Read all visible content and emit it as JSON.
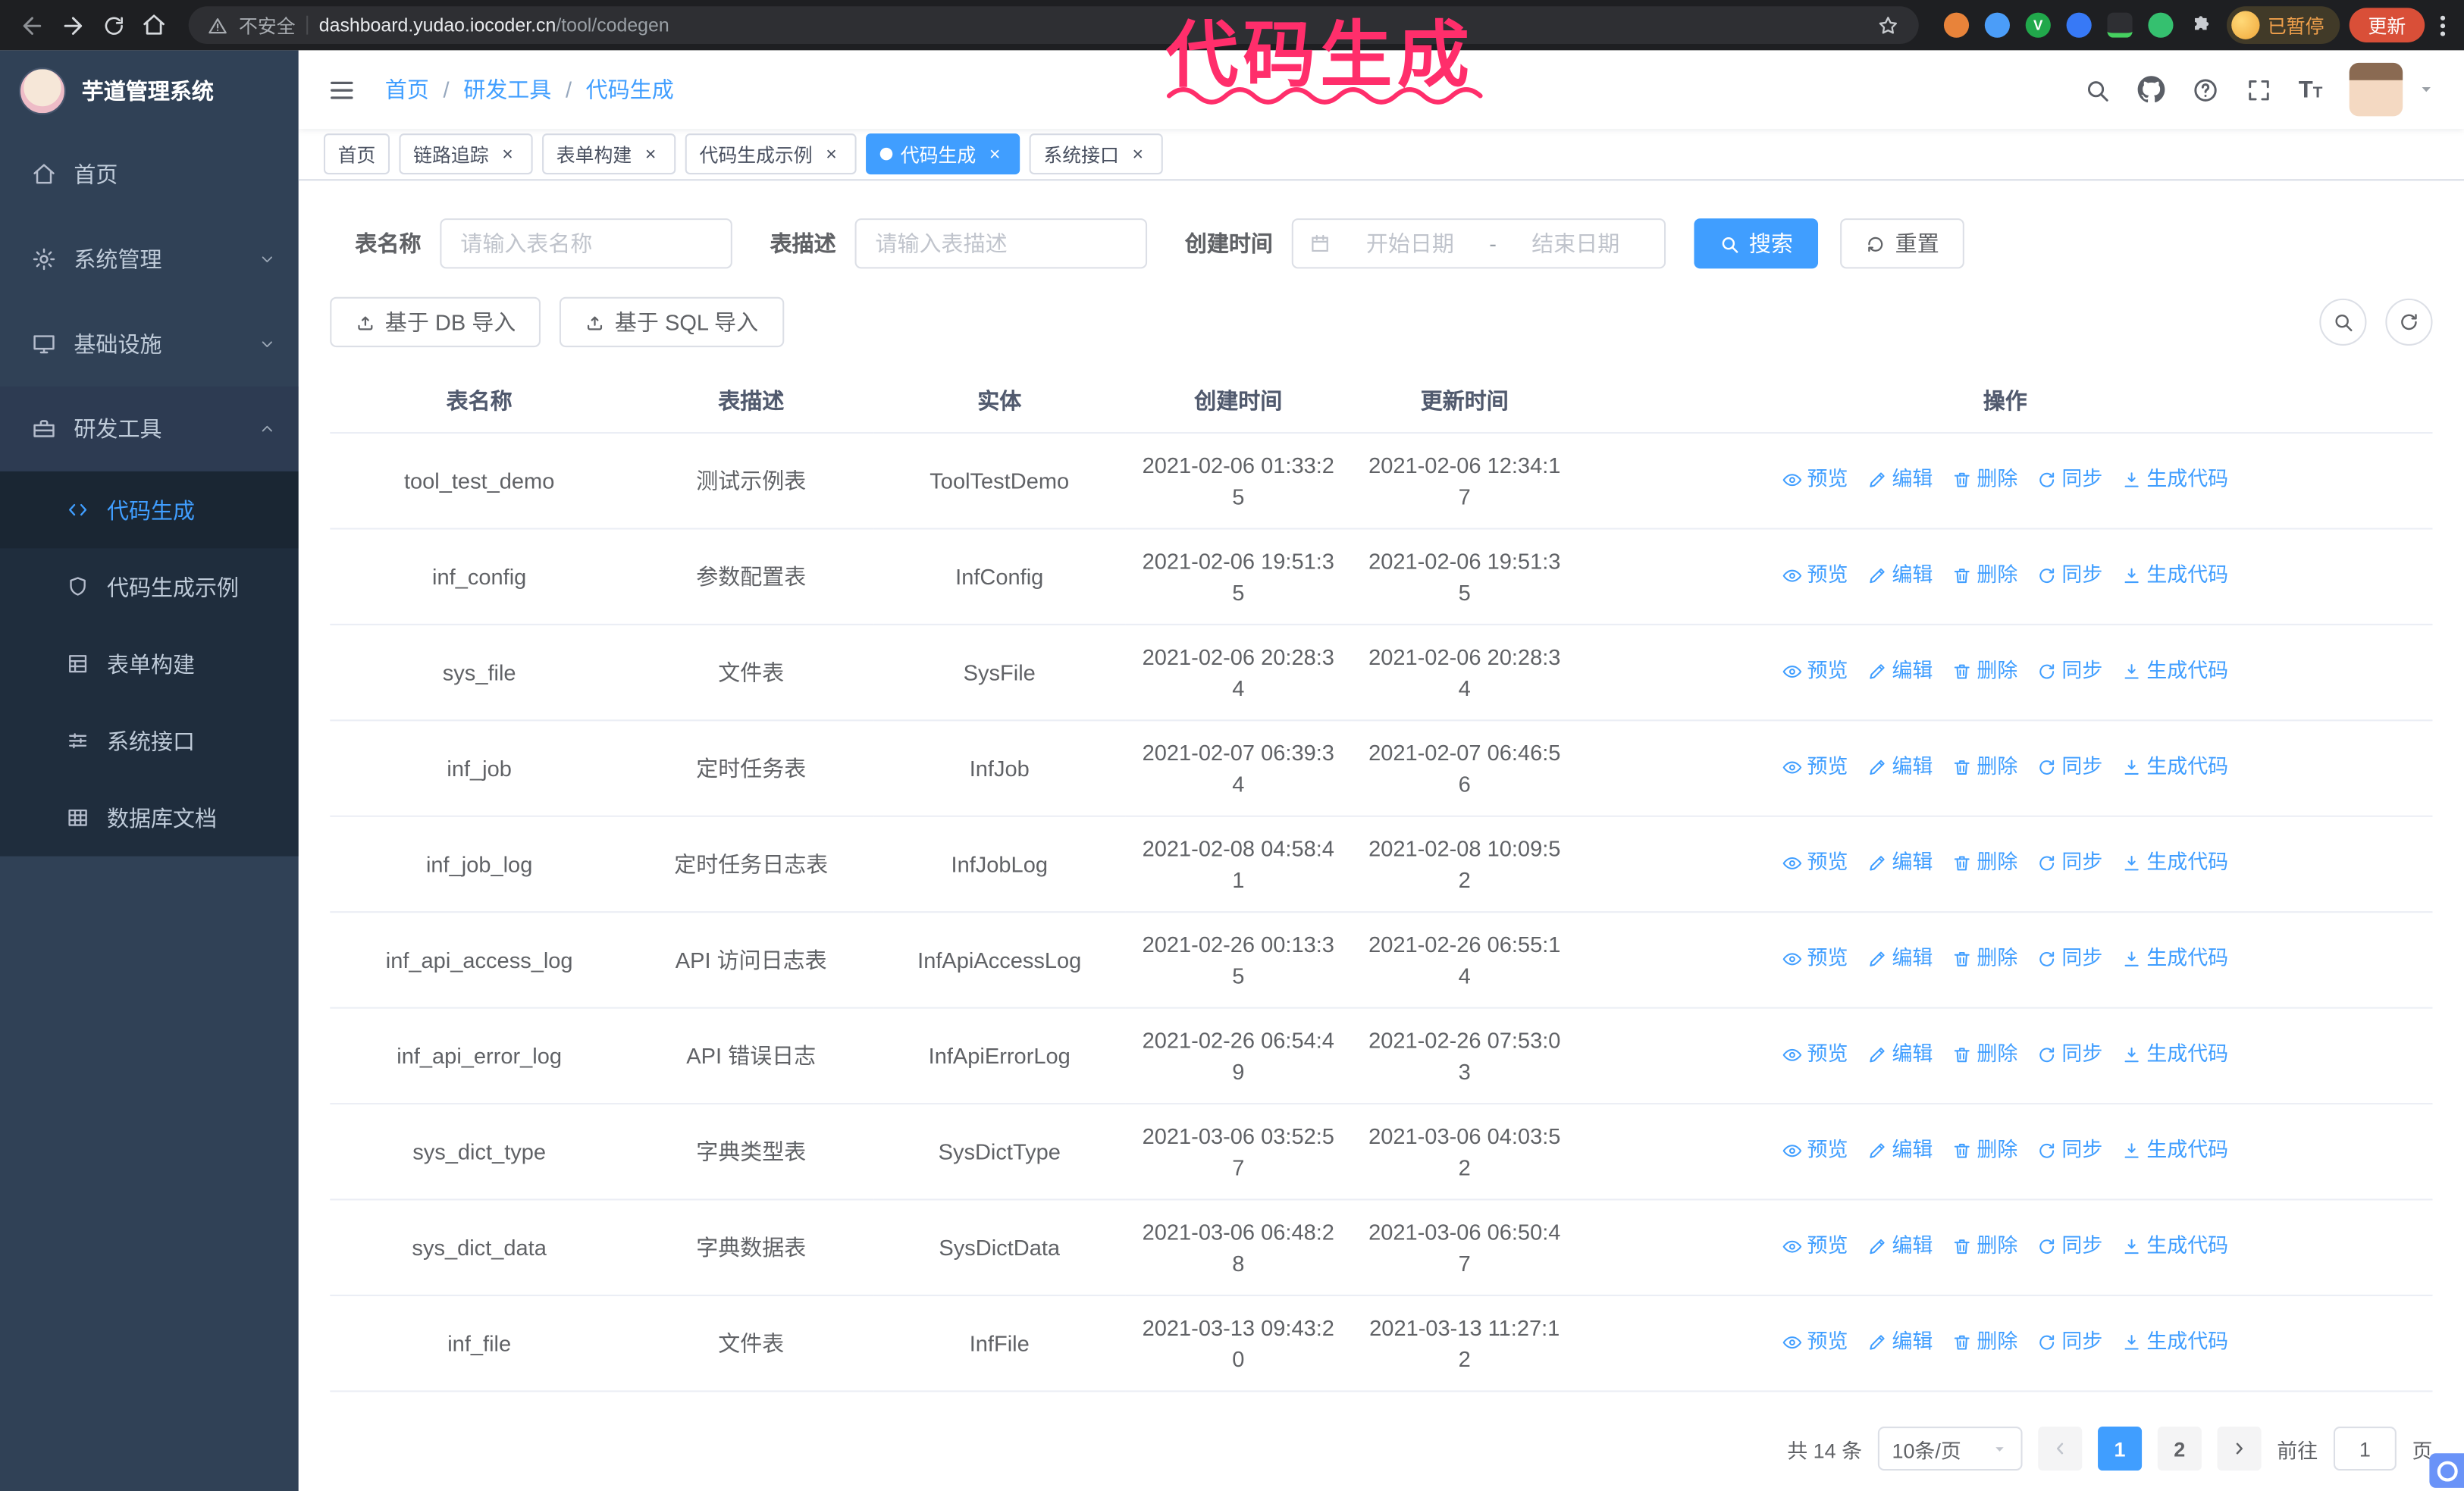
{
  "colors": {
    "accent": "#409eff",
    "annotation": "#ff2e6b"
  },
  "annotation": {
    "text": "代码生成"
  },
  "browser": {
    "security_label": "不安全",
    "url_domain": "dashboard.yudao.iocoder.cn",
    "url_path": "/tool/codegen",
    "profile_badge": "已暂停",
    "update_button": "更新"
  },
  "sidebar": {
    "app_title": "芋道管理系统",
    "items": [
      {
        "label": "首页",
        "icon": "home-icon"
      },
      {
        "label": "系统管理",
        "icon": "gear-icon",
        "expandable": true
      },
      {
        "label": "基础设施",
        "icon": "monitor-icon",
        "expandable": true
      },
      {
        "label": "研发工具",
        "icon": "toolbox-icon",
        "expandable": true,
        "expanded": true,
        "children": [
          {
            "label": "代码生成",
            "icon": "code-icon",
            "active": true
          },
          {
            "label": "代码生成示例",
            "icon": "shield-icon"
          },
          {
            "label": "表单构建",
            "icon": "form-grid-icon"
          },
          {
            "label": "系统接口",
            "icon": "sliders-icon"
          },
          {
            "label": "数据库文档",
            "icon": "table-icon"
          }
        ]
      }
    ]
  },
  "header": {
    "breadcrumb": [
      "首页",
      "研发工具",
      "代码生成"
    ]
  },
  "tabs": [
    {
      "label": "首页",
      "closable": false
    },
    {
      "label": "链路追踪",
      "closable": true
    },
    {
      "label": "表单构建",
      "closable": true
    },
    {
      "label": "代码生成示例",
      "closable": true
    },
    {
      "label": "代码生成",
      "closable": true,
      "active": true
    },
    {
      "label": "系统接口",
      "closable": true
    }
  ],
  "filters": {
    "table_name_label": "表名称",
    "table_name_placeholder": "请输入表名称",
    "table_desc_label": "表描述",
    "table_desc_placeholder": "请输入表描述",
    "create_time_label": "创建时间",
    "date_start_placeholder": "开始日期",
    "date_separator": "-",
    "date_end_placeholder": "结束日期",
    "search_button": "搜索",
    "reset_button": "重置"
  },
  "toolbar": {
    "import_db_button": "基于 DB 导入",
    "import_sql_button": "基于 SQL 导入"
  },
  "table": {
    "columns": [
      "表名称",
      "表描述",
      "实体",
      "创建时间",
      "更新时间",
      "操作"
    ],
    "actions": [
      {
        "label": "预览",
        "icon": "eye-icon"
      },
      {
        "label": "编辑",
        "icon": "edit-icon"
      },
      {
        "label": "删除",
        "icon": "trash-icon"
      },
      {
        "label": "同步",
        "icon": "sync-icon"
      },
      {
        "label": "生成代码",
        "icon": "generate-icon"
      }
    ],
    "rows": [
      {
        "name": "tool_test_demo",
        "desc": "测试示例表",
        "entity": "ToolTestDemo",
        "created": "2021-02-06 01:33:25",
        "updated": "2021-02-06 12:34:17"
      },
      {
        "name": "inf_config",
        "desc": "参数配置表",
        "entity": "InfConfig",
        "created": "2021-02-06 19:51:35",
        "updated": "2021-02-06 19:51:35"
      },
      {
        "name": "sys_file",
        "desc": "文件表",
        "entity": "SysFile",
        "created": "2021-02-06 20:28:34",
        "updated": "2021-02-06 20:28:34"
      },
      {
        "name": "inf_job",
        "desc": "定时任务表",
        "entity": "InfJob",
        "created": "2021-02-07 06:39:34",
        "updated": "2021-02-07 06:46:56"
      },
      {
        "name": "inf_job_log",
        "desc": "定时任务日志表",
        "entity": "InfJobLog",
        "created": "2021-02-08 04:58:41",
        "updated": "2021-02-08 10:09:52"
      },
      {
        "name": "inf_api_access_log",
        "desc": "API 访问日志表",
        "entity": "InfApiAccessLog",
        "created": "2021-02-26 00:13:35",
        "updated": "2021-02-26 06:55:14"
      },
      {
        "name": "inf_api_error_log",
        "desc": "API 错误日志",
        "entity": "InfApiErrorLog",
        "created": "2021-02-26 06:54:49",
        "updated": "2021-02-26 07:53:03"
      },
      {
        "name": "sys_dict_type",
        "desc": "字典类型表",
        "entity": "SysDictType",
        "created": "2021-03-06 03:52:57",
        "updated": "2021-03-06 04:03:52"
      },
      {
        "name": "sys_dict_data",
        "desc": "字典数据表",
        "entity": "SysDictData",
        "created": "2021-03-06 06:48:28",
        "updated": "2021-03-06 06:50:47"
      },
      {
        "name": "inf_file",
        "desc": "文件表",
        "entity": "InfFile",
        "created": "2021-03-13 09:43:20",
        "updated": "2021-03-13 11:27:12"
      }
    ]
  },
  "pagination": {
    "total": "共 14 条",
    "page_size": "10条/页",
    "active_page": "1",
    "pages": [
      "1",
      "2"
    ],
    "goto_label": "前往",
    "goto_value": "1",
    "goto_suffix": "页"
  }
}
